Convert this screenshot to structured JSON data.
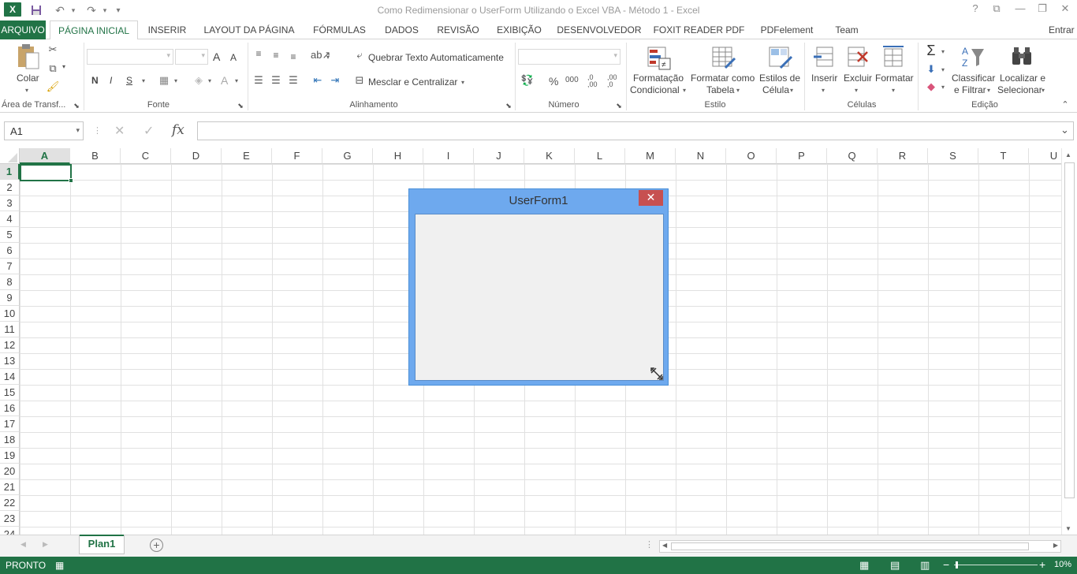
{
  "window": {
    "title": "Como Redimensionar o UserForm Utilizando o Excel VBA - Método 1 - Excel",
    "controls": {
      "help": "?",
      "ribbon_options": "⧉",
      "minimize": "—",
      "restore": "❐",
      "close": "✕"
    }
  },
  "quick_access": {
    "app_icon": "X",
    "save": "💾",
    "undo": "↶",
    "redo": "↷",
    "customize": "▾"
  },
  "tabs": [
    "ARQUIVO",
    "PÁGINA INICIAL",
    "INSERIR",
    "LAYOUT DA PÁGINA",
    "FÓRMULAS",
    "DADOS",
    "REVISÃO",
    "EXIBIÇÃO",
    "DESENVOLVEDOR",
    "FOXIT READER PDF",
    "PDFelement",
    "Team"
  ],
  "signin": "Entrar",
  "ribbon": {
    "clipboard": {
      "paste": "Colar",
      "label": "Área de Transf..."
    },
    "font": {
      "bold": "N",
      "italic": "I",
      "underline": "S",
      "grow": "A",
      "shrink": "A",
      "fontcolor": "A",
      "label": "Fonte"
    },
    "alignment": {
      "wrap": "Quebrar Texto Automaticamente",
      "merge": "Mesclar e Centralizar",
      "label": "Alinhamento"
    },
    "number": {
      "percent": "%",
      "thousands": "000",
      "inc_dec": ",0 ,00",
      "dec_dec": ",00 ,0",
      "label": "Número"
    },
    "styles": {
      "cond_fmt": [
        "Formatação",
        "Condicional"
      ],
      "fmt_table": [
        "Formatar como",
        "Tabela"
      ],
      "cell_styles": [
        "Estilos de",
        "Célula"
      ],
      "label": "Estilo"
    },
    "cells": {
      "insert": "Inserir",
      "delete": "Excluir",
      "format": "Formatar",
      "label": "Células"
    },
    "editing": {
      "sort": [
        "Classificar",
        "e Filtrar"
      ],
      "find": [
        "Localizar e",
        "Selecionar"
      ],
      "label": "Edição"
    }
  },
  "formula_bar": {
    "name_box": "A1",
    "cancel": "✕",
    "enter": "✓",
    "fx": "fx",
    "value": ""
  },
  "columns": [
    "A",
    "B",
    "C",
    "D",
    "E",
    "F",
    "G",
    "H",
    "I",
    "J",
    "K",
    "L",
    "M",
    "N",
    "O",
    "P",
    "Q",
    "R",
    "S",
    "T",
    "U"
  ],
  "rows": [
    "1",
    "2",
    "3",
    "4",
    "5",
    "6",
    "7",
    "8",
    "9",
    "10",
    "11",
    "12",
    "13",
    "14",
    "15",
    "16",
    "17",
    "18",
    "19",
    "20",
    "21",
    "22",
    "23",
    "24"
  ],
  "userform": {
    "title": "UserForm1",
    "close": "✕"
  },
  "sheets": [
    {
      "name": "Plan1"
    }
  ],
  "status": {
    "text": "PRONTO",
    "zoom": "10%"
  }
}
